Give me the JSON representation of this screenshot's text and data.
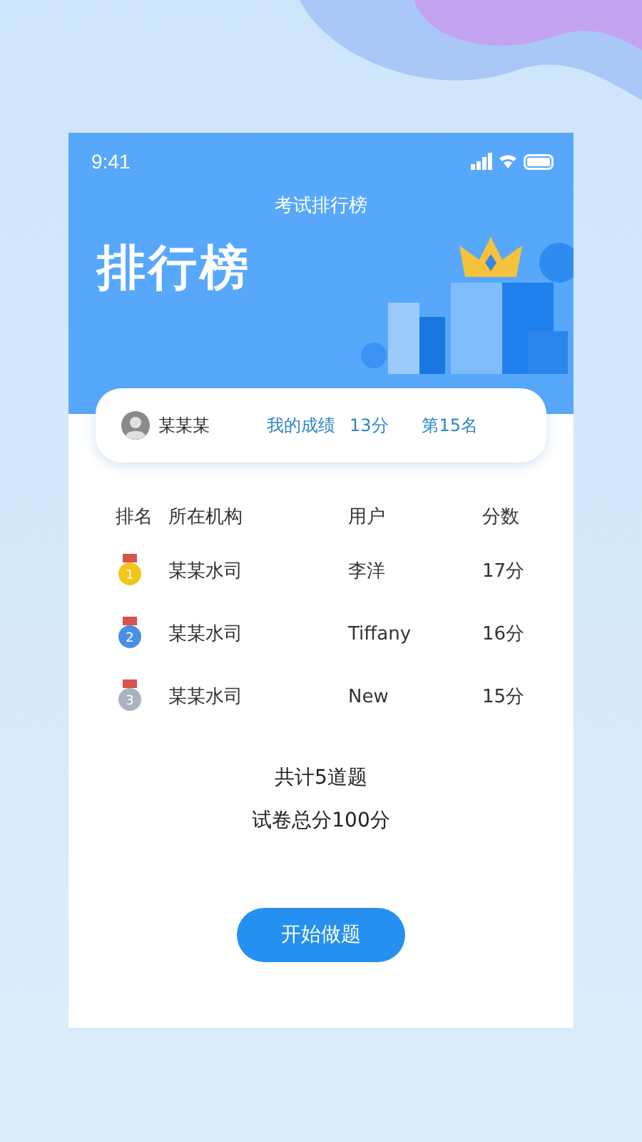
{
  "status_bar": {
    "time": "9:41"
  },
  "header": {
    "nav_title": "考试排行榜",
    "title": "排行榜"
  },
  "my_card": {
    "name": "某某某",
    "score_label": "我的成绩",
    "score": "13分",
    "rank": "第15名"
  },
  "table": {
    "columns": [
      "排名",
      "所在机构",
      "用户",
      "分数"
    ],
    "rows": [
      {
        "rank": "1",
        "color": "#f5c518",
        "org": "某某水司",
        "user": "李洋",
        "score": "17分"
      },
      {
        "rank": "2",
        "color": "#4a90e2",
        "org": "某某水司",
        "user": "Tiffany",
        "score": "16分"
      },
      {
        "rank": "3",
        "color": "#aab4c0",
        "org": "某某水司",
        "user": "New",
        "score": "15分"
      }
    ]
  },
  "summary": [
    "共计5道题",
    "试卷总分100分"
  ],
  "start_button": "开始做题"
}
